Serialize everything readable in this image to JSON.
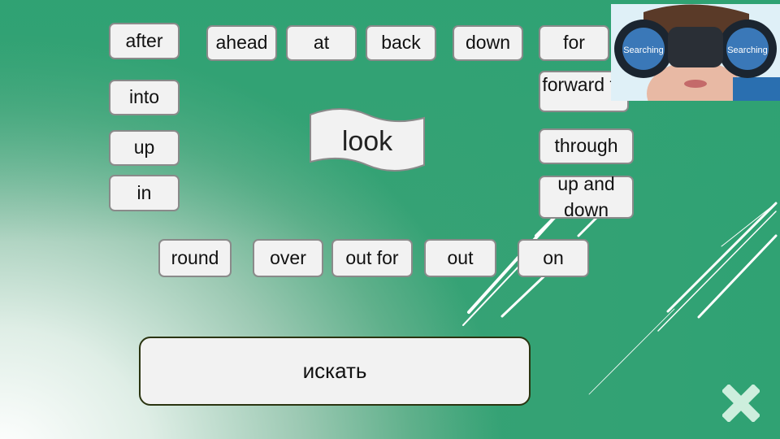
{
  "center_word": "look",
  "particles": [
    "after",
    "ahead",
    "at",
    "back",
    "down",
    "for",
    "into",
    "forward to",
    "up",
    "through",
    "in",
    "up and down",
    "round",
    "over",
    "out for",
    "out",
    "on"
  ],
  "answer": "искать",
  "photo": {
    "label": "Searching"
  },
  "colors": {
    "background": "#2fa273",
    "card": "#f2f2f2",
    "close": "#cdeedd"
  }
}
